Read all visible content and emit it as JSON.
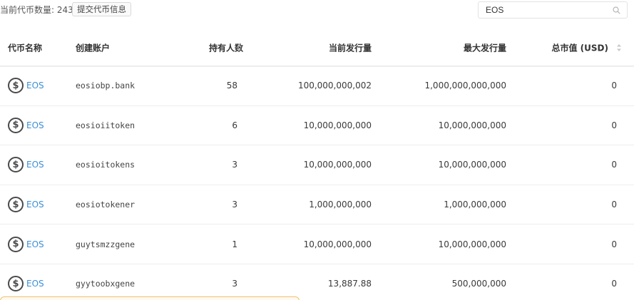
{
  "topbar": {
    "count_label": "当前代币数量: 243",
    "submit_label": "提交代币信息",
    "search_value": "EOS"
  },
  "table": {
    "headers": {
      "name": "代币名称",
      "creator": "创建账户",
      "holders": "持有人数",
      "supply": "当前发行量",
      "max_supply": "最大发行量",
      "market_cap": "总市值 (USD)"
    },
    "rows": [
      {
        "token": "EOS",
        "creator": "eosiobp.bank",
        "holders": "58",
        "supply": "100,000,000,002",
        "max_supply": "1,000,000,000,000",
        "market_cap": "0"
      },
      {
        "token": "EOS",
        "creator": "eosioiitoken",
        "holders": "6",
        "supply": "10,000,000,000",
        "max_supply": "10,000,000,000",
        "market_cap": "0"
      },
      {
        "token": "EOS",
        "creator": "eosioitokens",
        "holders": "3",
        "supply": "10,000,000,000",
        "max_supply": "10,000,000,000",
        "market_cap": "0"
      },
      {
        "token": "EOS",
        "creator": "eosiotokener",
        "holders": "3",
        "supply": "1,000,000,000",
        "max_supply": "1,000,000,000",
        "market_cap": "0"
      },
      {
        "token": "EOS",
        "creator": "guytsmzzgene",
        "holders": "1",
        "supply": "10,000,000,000",
        "max_supply": "10,000,000,000",
        "market_cap": "0"
      },
      {
        "token": "EOS",
        "creator": "gyytoobxgene",
        "holders": "3",
        "supply": "13,887.88",
        "max_supply": "500,000,000",
        "market_cap": "0"
      }
    ]
  },
  "icons": {
    "coin": "dollar-coin-icon",
    "search": "search-icon",
    "sort": "sort-icon"
  },
  "colors": {
    "link": "#3c8fd6",
    "toast_border": "#f0c070"
  }
}
